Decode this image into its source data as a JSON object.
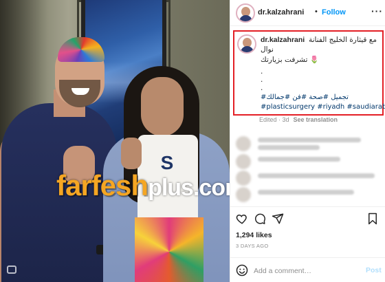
{
  "photo": {
    "watermark_main": "farfesh",
    "watermark_tail": "plus.com",
    "shirt_letter": "S"
  },
  "header": {
    "username": "dr.kalzahrani",
    "separator": "•",
    "follow_label": "Follow",
    "more_label": "···"
  },
  "caption": {
    "username": "dr.kalzahrani",
    "line1": "مع قيثارة الخليج الفنانة",
    "line2": "نوال",
    "line3": "🌷 تشرفت بزيارتك",
    "dots": [
      ".",
      ".",
      "."
    ],
    "hashtags_ar": "تجميل #صحة #فن #جمالك#",
    "hashtags_en": "#plasticsurgery #riyadh #saudiarabia"
  },
  "meta": {
    "edited": "Edited · 3d",
    "see_translation": "See translation"
  },
  "engagement": {
    "likes": "1,294 likes",
    "time_ago": "3 DAYS AGO"
  },
  "composer": {
    "placeholder": "Add a comment…",
    "post_label": "Post"
  },
  "colors": {
    "follow_blue": "#0095f6",
    "highlight_red": "#e31e24",
    "hashtag_blue": "#00376b",
    "watermark_orange": "#f5a623"
  }
}
